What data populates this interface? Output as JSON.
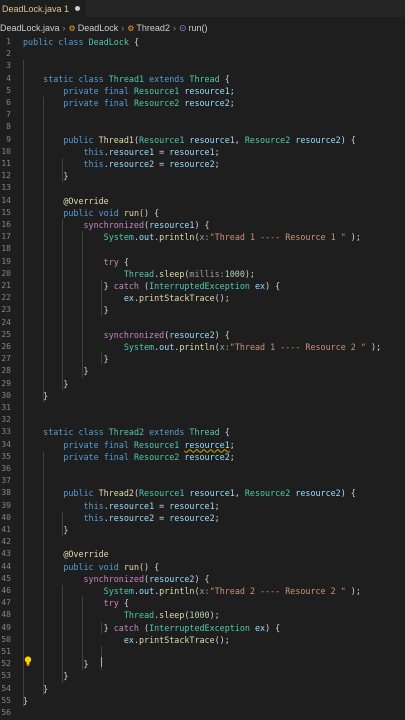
{
  "tab": {
    "label": "DeadLock.java 1"
  },
  "breadcrumb": [
    "DeadLock.java",
    "DeadLock",
    "Thread2",
    "run()"
  ],
  "lines": [
    {
      "n": "1",
      "t": [
        [
          "kw",
          "public "
        ],
        [
          "kw",
          "class "
        ],
        [
          "ty",
          "DeadLock"
        ],
        [
          "pn",
          " {"
        ]
      ]
    },
    {
      "n": "2",
      "t": []
    },
    {
      "n": "3",
      "t": []
    },
    {
      "n": "4",
      "t": [
        [
          "kw",
          "    static "
        ],
        [
          "kw",
          "class "
        ],
        [
          "ty",
          "Thread1 "
        ],
        [
          "kw",
          "extends "
        ],
        [
          "ty",
          "Thread"
        ],
        [
          "pn",
          " {"
        ]
      ]
    },
    {
      "n": "5",
      "t": [
        [
          "kw",
          "        private "
        ],
        [
          "kw",
          "final "
        ],
        [
          "ty",
          "Resource1 "
        ],
        [
          "var",
          "resource1"
        ],
        [
          "pn",
          ";"
        ]
      ]
    },
    {
      "n": "6",
      "t": [
        [
          "kw",
          "        private "
        ],
        [
          "kw",
          "final "
        ],
        [
          "ty",
          "Resource2 "
        ],
        [
          "var",
          "resource2"
        ],
        [
          "pn",
          ";"
        ]
      ]
    },
    {
      "n": "7",
      "t": []
    },
    {
      "n": "8",
      "t": []
    },
    {
      "n": "9",
      "t": [
        [
          "kw",
          "        public "
        ],
        [
          "fn",
          "Thread1"
        ],
        [
          "pn",
          "("
        ],
        [
          "ty",
          "Resource1 "
        ],
        [
          "var",
          "resource1"
        ],
        [
          "pn",
          ", "
        ],
        [
          "ty",
          "Resource2 "
        ],
        [
          "var",
          "resource2"
        ],
        [
          "pn",
          ") {"
        ]
      ]
    },
    {
      "n": "10",
      "t": [
        [
          "kw",
          "            this"
        ],
        [
          "pn",
          "."
        ],
        [
          "var",
          "resource1"
        ],
        [
          "pn",
          " = "
        ],
        [
          "var",
          "resource1"
        ],
        [
          "pn",
          ";"
        ]
      ]
    },
    {
      "n": "11",
      "t": [
        [
          "kw",
          "            this"
        ],
        [
          "pn",
          "."
        ],
        [
          "var",
          "resource2"
        ],
        [
          "pn",
          " = "
        ],
        [
          "var",
          "resource2"
        ],
        [
          "pn",
          ";"
        ]
      ]
    },
    {
      "n": "12",
      "t": [
        [
          "pn",
          "        }"
        ]
      ]
    },
    {
      "n": "13",
      "t": []
    },
    {
      "n": "14",
      "t": [
        [
          "ann",
          "        @Override"
        ]
      ]
    },
    {
      "n": "15",
      "t": [
        [
          "kw",
          "        public "
        ],
        [
          "kw",
          "void "
        ],
        [
          "fn",
          "run"
        ],
        [
          "pn",
          "() {"
        ]
      ]
    },
    {
      "n": "16",
      "t": [
        [
          "ctl",
          "            synchronized"
        ],
        [
          "pn",
          "("
        ],
        [
          "var",
          "resource1"
        ],
        [
          "pn",
          ") {"
        ]
      ]
    },
    {
      "n": "17",
      "t": [
        [
          "ty",
          "                System"
        ],
        [
          "pn",
          "."
        ],
        [
          "var",
          "out"
        ],
        [
          "pn",
          "."
        ],
        [
          "fn",
          "println"
        ],
        [
          "pn",
          "("
        ],
        [
          "hint",
          "x:"
        ],
        [
          "str",
          "\"Thread 1 ---- Resource 1 \""
        ],
        [
          "pn",
          " );"
        ]
      ]
    },
    {
      "n": "18",
      "t": []
    },
    {
      "n": "19",
      "t": [
        [
          "ctl",
          "                try"
        ],
        [
          "pn",
          " {"
        ]
      ]
    },
    {
      "n": "20",
      "t": [
        [
          "ty",
          "                    Thread"
        ],
        [
          "pn",
          "."
        ],
        [
          "fn",
          "sleep"
        ],
        [
          "pn",
          "("
        ],
        [
          "hint",
          "millis:"
        ],
        [
          "num",
          "1000"
        ],
        [
          "pn",
          ");"
        ]
      ]
    },
    {
      "n": "21",
      "t": [
        [
          "pn",
          "                } "
        ],
        [
          "ctl",
          "catch"
        ],
        [
          "pn",
          " ("
        ],
        [
          "ty",
          "InterruptedException "
        ],
        [
          "var",
          "ex"
        ],
        [
          "pn",
          ") {"
        ]
      ]
    },
    {
      "n": "22",
      "t": [
        [
          "var",
          "                    ex"
        ],
        [
          "pn",
          "."
        ],
        [
          "fn",
          "printStackTrace"
        ],
        [
          "pn",
          "();"
        ]
      ]
    },
    {
      "n": "23",
      "t": [
        [
          "pn",
          "                }"
        ]
      ]
    },
    {
      "n": "24",
      "t": []
    },
    {
      "n": "25",
      "t": [
        [
          "ctl",
          "                synchronized"
        ],
        [
          "pn",
          "("
        ],
        [
          "var",
          "resource2"
        ],
        [
          "pn",
          ") {"
        ]
      ]
    },
    {
      "n": "26",
      "t": [
        [
          "ty",
          "                    System"
        ],
        [
          "pn",
          "."
        ],
        [
          "var",
          "out"
        ],
        [
          "pn",
          "."
        ],
        [
          "fn",
          "println"
        ],
        [
          "pn",
          "("
        ],
        [
          "hint",
          "x:"
        ],
        [
          "str",
          "\"Thread 1 ---- Resource 2 \""
        ],
        [
          "pn",
          " );"
        ]
      ]
    },
    {
      "n": "27",
      "t": [
        [
          "pn",
          "                }"
        ]
      ]
    },
    {
      "n": "28",
      "t": [
        [
          "pn",
          "            }"
        ]
      ]
    },
    {
      "n": "29",
      "t": [
        [
          "pn",
          "        }"
        ]
      ]
    },
    {
      "n": "30",
      "t": [
        [
          "pn",
          "    }"
        ]
      ]
    },
    {
      "n": "31",
      "t": []
    },
    {
      "n": "32",
      "t": []
    },
    {
      "n": "33",
      "t": [
        [
          "kw",
          "    static "
        ],
        [
          "kw",
          "class "
        ],
        [
          "ty",
          "Thread2 "
        ],
        [
          "kw",
          "extends "
        ],
        [
          "ty",
          "Thread"
        ],
        [
          "pn",
          " {"
        ]
      ]
    },
    {
      "n": "34",
      "t": [
        [
          "kw",
          "        private "
        ],
        [
          "kw",
          "final "
        ],
        [
          "ty",
          "Resource1 "
        ],
        [
          "squig",
          "resource1"
        ],
        [
          "pn",
          ";"
        ]
      ]
    },
    {
      "n": "35",
      "t": [
        [
          "kw",
          "        private "
        ],
        [
          "kw",
          "final "
        ],
        [
          "ty",
          "Resource2 "
        ],
        [
          "var",
          "resource2"
        ],
        [
          "pn",
          ";"
        ]
      ]
    },
    {
      "n": "36",
      "t": []
    },
    {
      "n": "37",
      "t": []
    },
    {
      "n": "38",
      "t": [
        [
          "kw",
          "        public "
        ],
        [
          "fn",
          "Thread2"
        ],
        [
          "pn",
          "("
        ],
        [
          "ty",
          "Resource1 "
        ],
        [
          "var",
          "resource1"
        ],
        [
          "pn",
          ", "
        ],
        [
          "ty",
          "Resource2 "
        ],
        [
          "var",
          "resource2"
        ],
        [
          "pn",
          ") {"
        ]
      ]
    },
    {
      "n": "39",
      "t": [
        [
          "kw",
          "            this"
        ],
        [
          "pn",
          "."
        ],
        [
          "var",
          "resource1"
        ],
        [
          "pn",
          " = "
        ],
        [
          "var",
          "resource1"
        ],
        [
          "pn",
          ";"
        ]
      ]
    },
    {
      "n": "40",
      "t": [
        [
          "kw",
          "            this"
        ],
        [
          "pn",
          "."
        ],
        [
          "var",
          "resource2"
        ],
        [
          "pn",
          " = "
        ],
        [
          "var",
          "resource2"
        ],
        [
          "pn",
          ";"
        ]
      ]
    },
    {
      "n": "41",
      "t": [
        [
          "pn",
          "        }"
        ]
      ]
    },
    {
      "n": "42",
      "t": []
    },
    {
      "n": "43",
      "t": [
        [
          "ann",
          "        @Override"
        ]
      ]
    },
    {
      "n": "44",
      "t": [
        [
          "kw",
          "        public "
        ],
        [
          "kw",
          "void "
        ],
        [
          "fn",
          "run"
        ],
        [
          "pn",
          "() {"
        ]
      ]
    },
    {
      "n": "45",
      "t": [
        [
          "ctl",
          "            synchronized"
        ],
        [
          "pn",
          "("
        ],
        [
          "var",
          "resource2"
        ],
        [
          "pn",
          ") {"
        ]
      ]
    },
    {
      "n": "46",
      "t": [
        [
          "ty",
          "                System"
        ],
        [
          "pn",
          "."
        ],
        [
          "var",
          "out"
        ],
        [
          "pn",
          "."
        ],
        [
          "fn",
          "println"
        ],
        [
          "pn",
          "("
        ],
        [
          "hint",
          "x:"
        ],
        [
          "str",
          "\"Thread 2 ---- Resource 2 \""
        ],
        [
          "pn",
          " );"
        ]
      ]
    },
    {
      "n": "47",
      "t": [
        [
          "ctl",
          "                try"
        ],
        [
          "pn",
          " {"
        ]
      ]
    },
    {
      "n": "48",
      "t": [
        [
          "ty",
          "                    Thread"
        ],
        [
          "pn",
          "."
        ],
        [
          "fn",
          "sleep"
        ],
        [
          "pn",
          "("
        ],
        [
          "num",
          "1000"
        ],
        [
          "pn",
          ");"
        ]
      ]
    },
    {
      "n": "49",
      "t": [
        [
          "pn",
          "                } "
        ],
        [
          "ctl",
          "catch"
        ],
        [
          "pn",
          " ("
        ],
        [
          "ty",
          "InterruptedException "
        ],
        [
          "var",
          "ex"
        ],
        [
          "pn",
          ") {"
        ]
      ]
    },
    {
      "n": "50",
      "t": [
        [
          "var",
          "                    ex"
        ],
        [
          "pn",
          "."
        ],
        [
          "fn",
          "printStackTrace"
        ],
        [
          "pn",
          "();"
        ]
      ]
    },
    {
      "n": "51",
      "t": [
        [
          "pn",
          "                "
        ]
      ]
    },
    {
      "n": "52",
      "t": [
        [
          "pn",
          "            }"
        ]
      ]
    },
    {
      "n": "53",
      "t": [
        [
          "pn",
          "        }"
        ]
      ]
    },
    {
      "n": "54",
      "t": [
        [
          "pn",
          "    }"
        ]
      ]
    },
    {
      "n": "55",
      "t": [
        [
          "pn",
          "}"
        ]
      ]
    },
    {
      "n": "56",
      "t": []
    }
  ],
  "colors": {
    "background": "#1e1e1e",
    "keyword": "#569cd6",
    "type": "#4ec9b0",
    "function": "#dcdcaa",
    "variable": "#9cdcfe",
    "string": "#ce9178",
    "number": "#b5cea8",
    "modified_tab": "#e2c08d"
  },
  "icons": [
    "java-file-icon",
    "class-icon",
    "method-icon",
    "lightbulb-icon"
  ]
}
